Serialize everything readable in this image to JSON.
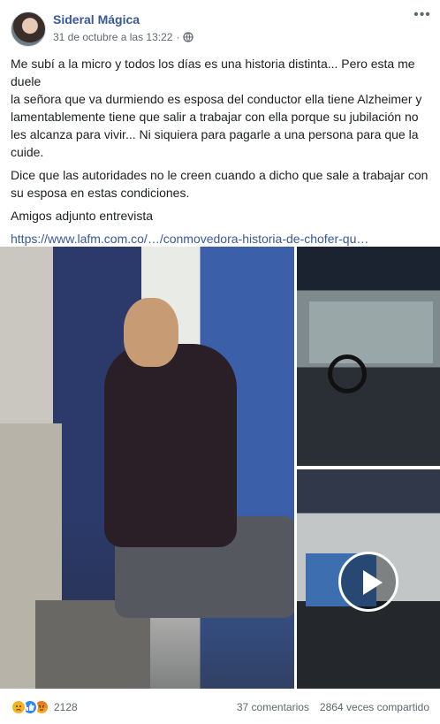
{
  "post": {
    "author": "Sideral Mágica",
    "timestamp": "31 de octubre a las 13:22",
    "separator": "·",
    "privacy_icon": "globe-icon",
    "more_icon": "more-options-icon",
    "paragraph1_lines": [
      "Me subí a la micro y todos los días es una historia distinta... Pero esta me duele",
      "la señora que va durmiendo es esposa del conductor ella tiene Alzheimer y lamentablemente tiene que salir a trabajar con ella porque su jubilación no les alcanza para vivir... Ni siquiera para pagarle a una persona para que la cuide."
    ],
    "paragraph2": "Dice que las autoridades no le creen cuando a dicho que sale a trabajar con su esposa en estas condiciones.",
    "paragraph3": "Amigos adjunto entrevista",
    "link_text": "https://www.lafm.com.co/…/conmovedora-historia-de-chofer-qu…"
  },
  "media": {
    "photos": [
      "photo-woman-sleeping",
      "photo-bus-driver",
      "video-bus-windshield"
    ],
    "play_icon": "play-icon"
  },
  "footer": {
    "reactions": [
      "sad-reaction-icon",
      "like-reaction-icon",
      "angry-reaction-icon"
    ],
    "reaction_count": "2128",
    "comments": "37 comentarios",
    "shares": "2864 veces compartido"
  },
  "colors": {
    "author": "#385898",
    "link": "#385898",
    "secondary_text": "#616770",
    "body_text": "#1c1e21"
  }
}
